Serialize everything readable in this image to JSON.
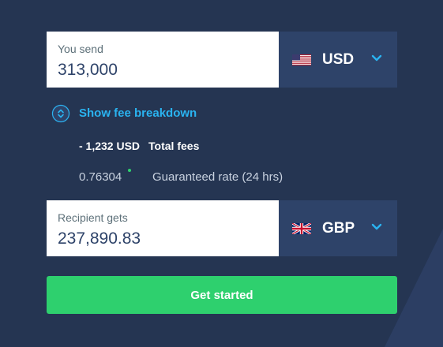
{
  "send": {
    "label": "You send",
    "value": "313,000",
    "currency": "USD",
    "flag_icon": "us-flag-icon"
  },
  "fees": {
    "toggle_label": "Show fee breakdown",
    "toggle_icon": "chevron-up-down-icon",
    "total_fee_amount": "- 1,232 USD",
    "total_fee_label": "Total fees",
    "rate_value": "0.76304",
    "rate_label": "Guaranteed rate (24 hrs)"
  },
  "receive": {
    "label": "Recipient gets",
    "value": "237,890.83",
    "currency": "GBP",
    "flag_icon": "uk-flag-icon"
  },
  "cta": {
    "label": "Get started"
  },
  "colors": {
    "background": "#253552",
    "panel": "#2e4369",
    "accent_blue": "#2ab3f0",
    "accent_green": "#2ed06e",
    "text_primary": "#2e4369",
    "text_muted": "#5d7079"
  }
}
